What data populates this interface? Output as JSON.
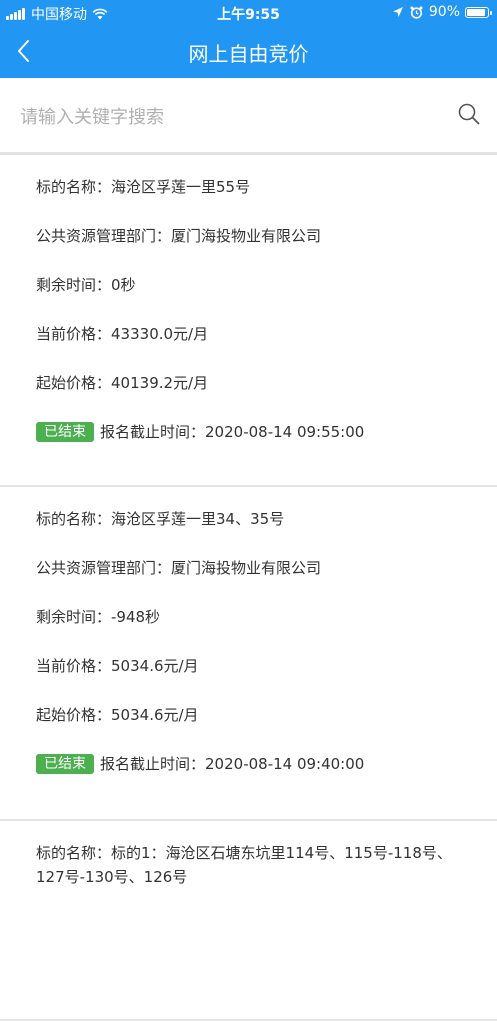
{
  "status_bar": {
    "carrier": "中国移动",
    "time": "上午9:55",
    "battery": "90%",
    "battery_level": 0.9,
    "icons": [
      "signal-icon",
      "wifi-icon",
      "location-icon",
      "alarm-icon",
      "battery-icon"
    ]
  },
  "nav": {
    "title": "网上自由竞价",
    "back_icon": "chevron-left-icon"
  },
  "search": {
    "placeholder": "请输入关键字搜索",
    "value": "",
    "icon": "search-icon"
  },
  "colors": {
    "primary": "#2196F3",
    "badge_ended": "#4caf50"
  },
  "items": [
    {
      "name_label": "标的名称：",
      "name": "海沧区孚莲一里55号",
      "dept_label": "公共资源管理部门：",
      "dept": "厦门海投物业有限公司",
      "remaining_label": "剩余时间：",
      "remaining": "0秒",
      "current_label": "当前价格：",
      "current_price": "43330.0元/月",
      "start_label": "起始价格：",
      "start_price": "40139.2元/月",
      "status": "已结束",
      "deadline_label": "报名截止时间：",
      "deadline": "2020-08-14 09:55:00"
    },
    {
      "name_label": "标的名称：",
      "name": "海沧区孚莲一里34、35号",
      "dept_label": "公共资源管理部门：",
      "dept": "厦门海投物业有限公司",
      "remaining_label": "剩余时间：",
      "remaining": "-948秒",
      "current_label": "当前价格：",
      "current_price": "5034.6元/月",
      "start_label": "起始价格：",
      "start_price": "5034.6元/月",
      "status": "已结束",
      "deadline_label": "报名截止时间：",
      "deadline": "2020-08-14 09:40:00"
    },
    {
      "name_label": "标的名称：",
      "name": "标的1：海沧区石塘东坑里114号、115号-118号、127号-130号、126号"
    }
  ]
}
